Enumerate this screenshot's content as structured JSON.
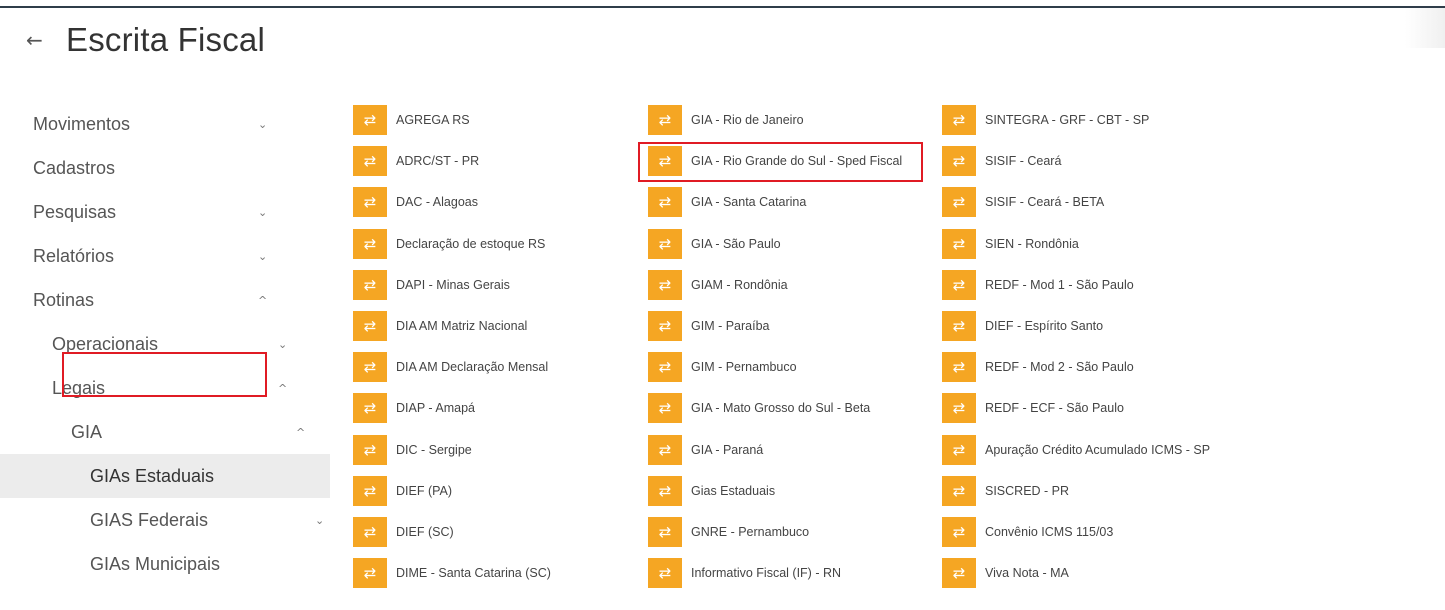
{
  "header": {
    "back_icon": "←",
    "title": "Escrita Fiscal"
  },
  "icons": {
    "chevron_down": "⌄",
    "chevron_up": "^",
    "transfer": "⇄"
  },
  "colors": {
    "accent": "#f5a623",
    "highlight": "#e01b24",
    "topbar": "#2f3d4a"
  },
  "sidebar": {
    "items": [
      {
        "label": "Movimentos",
        "chevron": "⌄"
      },
      {
        "label": "Cadastros",
        "chevron": ""
      },
      {
        "label": "Pesquisas",
        "chevron": "⌄"
      },
      {
        "label": "Relatórios",
        "chevron": "⌄"
      },
      {
        "label": "Rotinas",
        "chevron": "^"
      },
      {
        "label": "Operacionais",
        "chevron": "⌄"
      },
      {
        "label": "Legais",
        "chevron": "^"
      },
      {
        "label": "GIA",
        "chevron": "^"
      },
      {
        "label": "GIAs Estaduais",
        "chevron": ""
      },
      {
        "label": "GIAS Federais",
        "chevron": "⌄"
      },
      {
        "label": "GIAs Municipais",
        "chevron": ""
      }
    ]
  },
  "grid": {
    "col1": [
      "AGREGA RS",
      "ADRC/ST - PR",
      "DAC - Alagoas",
      "Declaração de estoque RS",
      "DAPI - Minas Gerais",
      "DIA AM Matriz Nacional",
      "DIA AM Declaração Mensal",
      "DIAP - Amapá",
      "DIC - Sergipe",
      "DIEF (PA)",
      "DIEF (SC)",
      "DIME - Santa Catarina (SC)"
    ],
    "col2": [
      "GIA - Rio de Janeiro",
      "GIA - Rio Grande do Sul - Sped Fiscal",
      "GIA - Santa Catarina",
      "GIA - São Paulo",
      "GIAM - Rondônia",
      "GIM - Paraíba",
      "GIM - Pernambuco",
      "GIA - Mato Grosso do Sul - Beta",
      "GIA - Paraná",
      "Gias Estaduais",
      "GNRE - Pernambuco",
      "Informativo Fiscal (IF) - RN"
    ],
    "col3": [
      "SINTEGRA - GRF - CBT - SP",
      "SISIF - Ceará",
      "SISIF - Ceará - BETA",
      "SIEN - Rondônia",
      "REDF - Mod 1 - São Paulo",
      "DIEF - Espírito Santo",
      "REDF - Mod 2 - São Paulo",
      "REDF - ECF - São Paulo",
      "Apuração Crédito Acumulado ICMS - SP",
      "SISCRED - PR",
      "Convênio ICMS 115/03",
      "Viva Nota - MA"
    ]
  }
}
